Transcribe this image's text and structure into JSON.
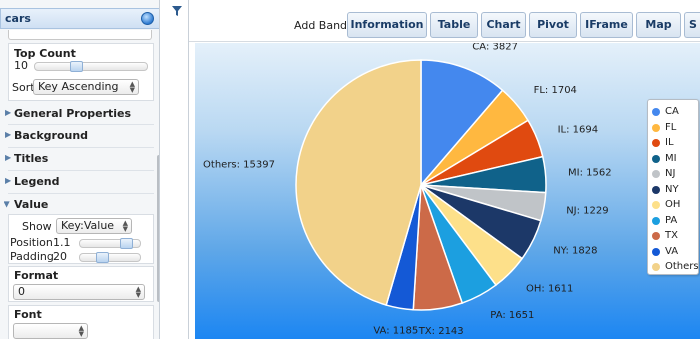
{
  "panel": {
    "title": "cars",
    "top_count": {
      "label": "Top Count",
      "value": "10",
      "slider_fraction": 0.35
    },
    "sort": {
      "label": "Sort",
      "value": "Key Ascending"
    },
    "sections": [
      {
        "label": "General Properties",
        "expanded": false
      },
      {
        "label": "Background",
        "expanded": false
      },
      {
        "label": "Titles",
        "expanded": false
      },
      {
        "label": "Legend",
        "expanded": false
      },
      {
        "label": "Value",
        "expanded": true
      }
    ],
    "value": {
      "show": {
        "label": "Show",
        "value": "Key:Value"
      },
      "position": {
        "label": "Position",
        "value": "1.1",
        "slider_fraction": 0.85
      },
      "padding": {
        "label": "Padding",
        "value": "20",
        "slider_fraction": 0.35
      }
    },
    "format": {
      "label": "Format",
      "value": "0"
    },
    "font": {
      "label": "Font",
      "value": ""
    }
  },
  "toolbar": {
    "add_band_label": "Add Band:",
    "buttons": [
      "Information",
      "Table",
      "Chart",
      "Pivot",
      "IFrame",
      "Map",
      "S"
    ]
  },
  "chart_data": {
    "type": "pie",
    "title": "",
    "slices": [
      {
        "name": "CA",
        "value": 3827,
        "color": "#4488ee"
      },
      {
        "name": "FL",
        "value": 1704,
        "color": "#ffb840"
      },
      {
        "name": "IL",
        "value": 1694,
        "color": "#e04a10"
      },
      {
        "name": "MI",
        "value": 1562,
        "color": "#10628a"
      },
      {
        "name": "NJ",
        "value": 1229,
        "color": "#c0c4c8"
      },
      {
        "name": "NY",
        "value": 1828,
        "color": "#1c3868"
      },
      {
        "name": "OH",
        "value": 1611,
        "color": "#fde08a"
      },
      {
        "name": "PA",
        "value": 1651,
        "color": "#1c9fe0"
      },
      {
        "name": "TX",
        "value": 2143,
        "color": "#cc6a48"
      },
      {
        "name": "VA",
        "value": 1185,
        "color": "#1459d6"
      },
      {
        "name": "Others",
        "value": 15397,
        "color": "#f2d28a"
      }
    ],
    "label_format": "Key:Value",
    "legend_position": "right",
    "start_angle_deg": 0,
    "direction": "clockwise"
  }
}
